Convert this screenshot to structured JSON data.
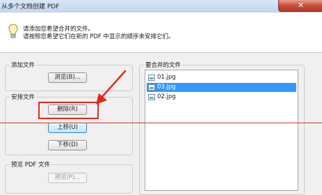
{
  "window": {
    "title": "从多个文档创建 PDF",
    "close_glyph": "✕"
  },
  "info": {
    "icon": "lightbulb-icon",
    "line1": "请添加您希望合并的文件。",
    "line2": "请按照您希望它们在新的 PDF 中显示的顺序来安排它们。"
  },
  "add_files": {
    "label": "添加文件",
    "browse_button": "浏览(B)..."
  },
  "arrange_files": {
    "label": "安排文件",
    "delete_button": "删除(R)",
    "move_up_button": "上移(U)",
    "move_down_button": "下移(D)"
  },
  "preview": {
    "label": "预览 PDF 文件",
    "preview_button": "预览(P)..."
  },
  "files_to_merge": {
    "label": "要合并的文件",
    "items": [
      {
        "name": "01.jpg",
        "selected": false
      },
      {
        "name": "03.jpg",
        "selected": true
      },
      {
        "name": "02.jpg",
        "selected": false
      }
    ]
  },
  "colors": {
    "annotation_red": "#e0291c",
    "selection": "#3399ff"
  }
}
